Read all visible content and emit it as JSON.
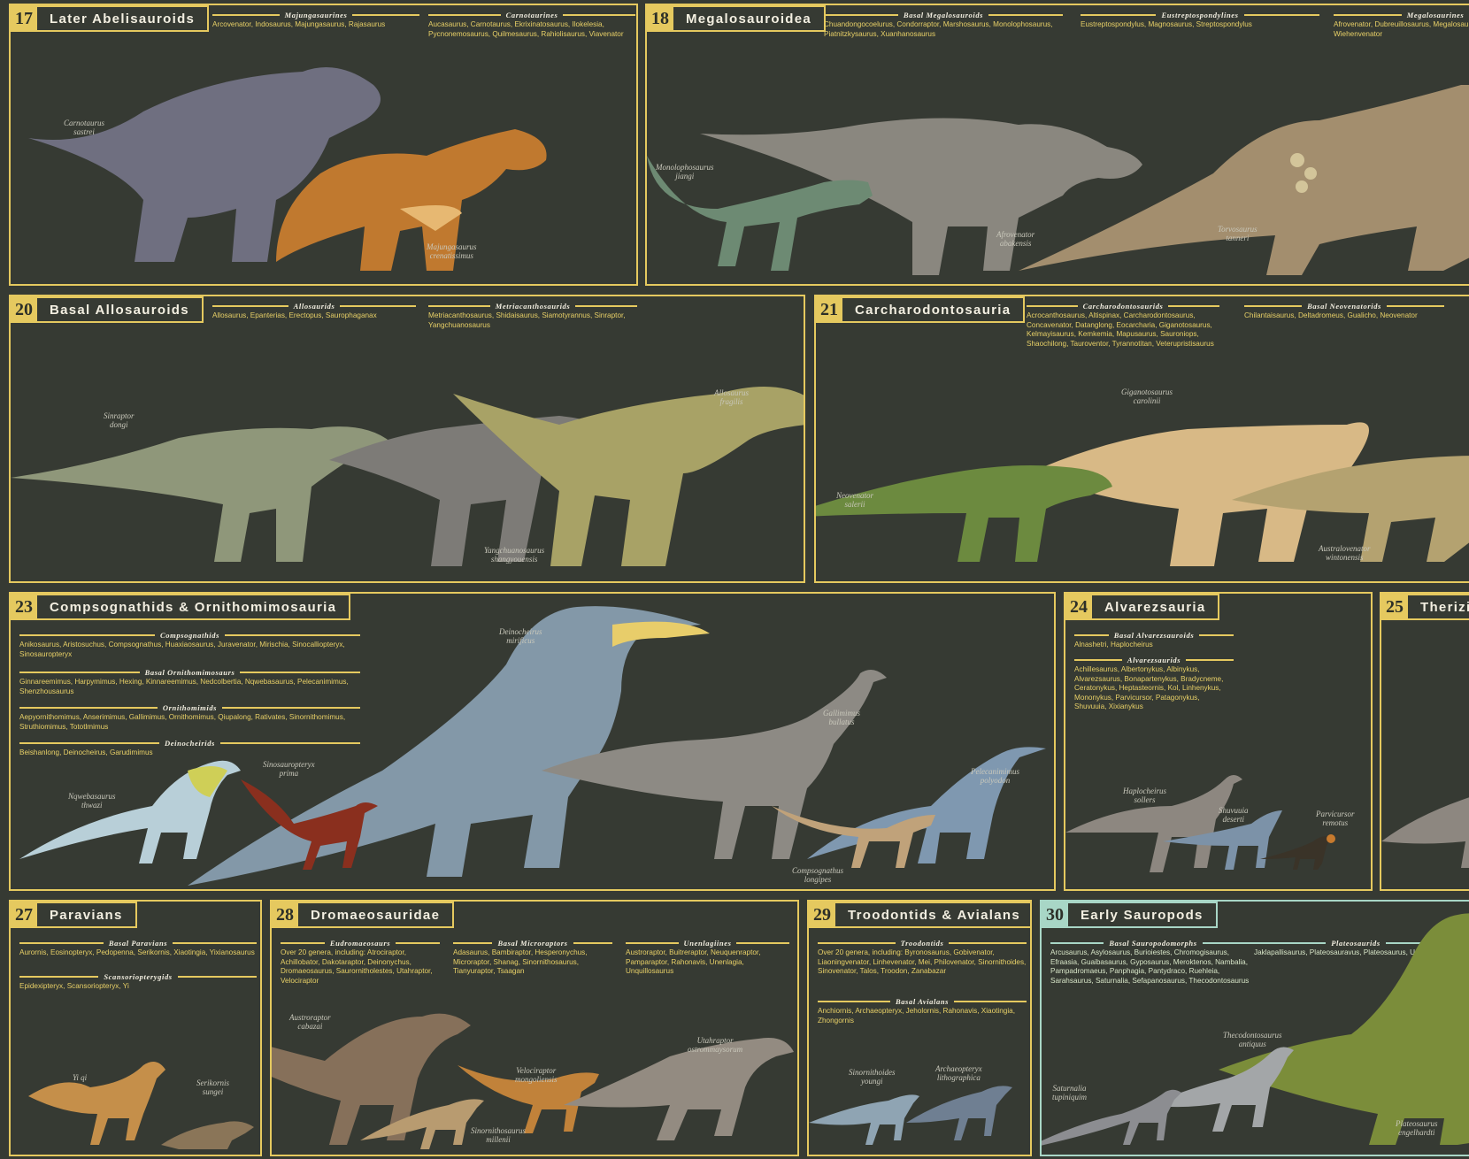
{
  "colors": {
    "background": "#363a33",
    "accent": "#e5c95f",
    "accent_mint": "#a8d6c6",
    "title_text": "#f3efe1",
    "genus_text": "#e8d067",
    "caption_text": "#c9c8bb"
  },
  "panels": [
    {
      "id": "p17",
      "num": "17",
      "title": "Later Abelisauroids",
      "groups": [
        {
          "title": "Majungasaurines",
          "text": "Arcovenator, Indosaurus, Majungasaurus, Rajasaurus"
        },
        {
          "title": "Carnotaurines",
          "text": "Aucasaurus, Carnotaurus, Ekrixinatosaurus, Ilokelesia, Pycnonemosaurus, Quilmesaurus, Rahiolisaurus, Viavenator"
        }
      ],
      "captions": [
        {
          "l1": "Carnotaurus",
          "l2": "sastrei"
        },
        {
          "l1": "Majungasaurus",
          "l2": "crenatissimus"
        }
      ]
    },
    {
      "id": "p18",
      "num": "18",
      "title": "Megalosauroidea",
      "groups": [
        {
          "title": "Basal Megalosauroids",
          "text": "Chuandongocoelurus, Condorraptor, Marshosaurus, Monolophosaurus, Piatnitzkysaurus, Xuanhanosaurus"
        },
        {
          "title": "Eustreptospondylines",
          "text": "Eustreptospondylus, Magnosaurus, Streptospondylus"
        },
        {
          "title": "Megalosaurines",
          "text": "Afrovenator, Dubreuillosaurus, Megalosaurus, Torvosaurus, Wiehenvenator"
        }
      ],
      "captions": [
        {
          "l1": "Monolophosaurus",
          "l2": "jiangi"
        },
        {
          "l1": "Afrovenator",
          "l2": "abakensis"
        },
        {
          "l1": "Torvosaurus",
          "l2": "tanneri"
        }
      ]
    },
    {
      "id": "p20",
      "num": "20",
      "title": "Basal Allosauroids",
      "groups": [
        {
          "title": "Allosaurids",
          "text": "Allosaurus, Epanterias, Erectopus, Saurophaganax"
        },
        {
          "title": "Metriacanthosaurids",
          "text": "Metriacanthosaurus, Shidaisaurus, Siamotyrannus, Sinraptor, Yangchuanosaurus"
        }
      ],
      "captions": [
        {
          "l1": "Sinraptor",
          "l2": "dongi"
        },
        {
          "l1": "Allosaurus",
          "l2": "fragilis"
        },
        {
          "l1": "Yangchuanosaurus",
          "l2": "shangyouensis"
        }
      ]
    },
    {
      "id": "p21",
      "num": "21",
      "title": "Carcharodontosauria",
      "groups": [
        {
          "title": "Carcharodontosaurids",
          "text": "Acrocanthosaurus, Altispinax, Carcharodontosaurus, Concavenator, Datanglong, Eocarcharia, Giganotosaurus, Kelmayisaurus, Kemkemia, Mapusaurus, Sauroniops, Shaochilong, Tauroventor, Tyrannotitan, Veterupristisaurus"
        },
        {
          "title": "Basal Neovenatorids",
          "text": "Chilantaisaurus, Deltadromeus, Gualicho, Neovenator"
        }
      ],
      "captions": [
        {
          "l1": "Giganotosaurus",
          "l2": "carolinii"
        },
        {
          "l1": "Neovenator",
          "l2": "salerii"
        },
        {
          "l1": "Australovenator",
          "l2": "wintonensis"
        }
      ]
    },
    {
      "id": "p23",
      "num": "23",
      "title": "Compsognathids & Ornithomimosauria",
      "groups": [
        {
          "title": "Compsognathids",
          "text": "Anikosaurus, Aristosuchus, Compsognathus, Huaxiaosaurus, Juravenator, Mirischia, Sinocalliopteryx, Sinosauropteryx"
        },
        {
          "title": "Basal Ornithomimosaurs",
          "text": "Ginnareemimus, Harpymimus, Hexing, Kinnareemimus, Nedcolbertia, Nqwebasaurus, Pelecanimimus, Shenzhousaurus"
        },
        {
          "title": "Ornithomimids",
          "text": "Aepyornithomimus, Anserimimus, Gallimimus, Ornithomimus, Qiupalong, Rativates, Sinornithomimus, Struthiomimus, Tototlmimus"
        },
        {
          "title": "Deinocheirids",
          "text": "Beishanlong, Deinocheirus, Garudimimus"
        }
      ],
      "captions": [
        {
          "l1": "Deinocheirus",
          "l2": "mirificus"
        },
        {
          "l1": "Gallimimus",
          "l2": "bullatus"
        },
        {
          "l1": "Sinosauropteryx",
          "l2": "prima"
        },
        {
          "l1": "Nqwebasaurus",
          "l2": "thwazi"
        },
        {
          "l1": "Pelecanimimus",
          "l2": "polyodon"
        },
        {
          "l1": "Compsognathus",
          "l2": "longipes"
        }
      ]
    },
    {
      "id": "p24",
      "num": "24",
      "title": "Alvarezsauria",
      "groups": [
        {
          "title": "Basal Alvarezsauroids",
          "text": "Alnashetri, Haplocheirus"
        },
        {
          "title": "Alvarezsaurids",
          "text": "Achillesaurus, Albertonykus, Albinykus, Alvarezsaurus, Bonapartenykus, Bradycneme, Ceratonykus, Heptasteornis, Kol, Linhenykus, Mononykus, Parvicursor, Patagonykus, Shuvuuia, Xixianykus"
        }
      ],
      "captions": [
        {
          "l1": "Haplocheirus",
          "l2": "sollers"
        },
        {
          "l1": "Shuvuuia",
          "l2": "deserti"
        },
        {
          "l1": "Parvicursor",
          "l2": "remotus"
        }
      ]
    },
    {
      "id": "p25",
      "num": "25",
      "title": "Therizinosauria",
      "groups": [],
      "captions": []
    },
    {
      "id": "p27",
      "num": "27",
      "title": "Paravians",
      "groups": [
        {
          "title": "Basal Paravians",
          "text": "Aurornis, Eosinopteryx, Pedopenna, Serikornis, Xiaotingia, Yixianosaurus"
        },
        {
          "title": "Scansoriopterygids",
          "text": "Epidexipteryx, Scansoriopteryx, Yi"
        }
      ],
      "captions": [
        {
          "l1": "Yi qi",
          "l2": ""
        },
        {
          "l1": "Serikornis",
          "l2": "sungei"
        }
      ]
    },
    {
      "id": "p28",
      "num": "28",
      "title": "Dromaeosauridae",
      "groups": [
        {
          "title": "Eudromaeosaurs",
          "text": "Over 20 genera, including: Atrociraptor, Achillobator, Dakotaraptor, Deinonychus, Dromaeosaurus, Saurornitholestes, Utahraptor, Velociraptor"
        },
        {
          "title": "Basal Microraptors",
          "text": "Adasaurus, Bambiraptor, Hesperonychus, Microraptor, Shanag, Sinornithosaurus, Tianyuraptor, Tsaagan"
        },
        {
          "title": "Unenlagiines",
          "text": "Austroraptor, Buitreraptor, Neuquenraptor, Pamparaptor, Rahonavis, Unenlagia, Unquillosaurus"
        }
      ],
      "captions": [
        {
          "l1": "Austroraptor",
          "l2": "cabazai"
        },
        {
          "l1": "Velociraptor",
          "l2": "mongoliensis"
        },
        {
          "l1": "Utahraptor",
          "l2": "ostrommaysorum"
        },
        {
          "l1": "Sinornithosaurus",
          "l2": "millenii"
        }
      ]
    },
    {
      "id": "p29",
      "num": "29",
      "title": "Troodontids & Avialans",
      "groups": [
        {
          "title": "Troodontids",
          "text": "Over 20 genera, including: Byronosaurus, Gobivenator, Liaoningvenator, Linhevenator, Mei, Philovenator, Sinornithoides, Sinovenator, Talos, Troodon, Zanabazar"
        },
        {
          "title": "Basal Avialans",
          "text": "Anchiornis, Archaeopteryx, Jeholornis, Rahonavis, Xiaotingia, Zhongornis"
        }
      ],
      "captions": [
        {
          "l1": "Sinornithoides",
          "l2": "youngi"
        },
        {
          "l1": "Archaeopteryx",
          "l2": "lithographica"
        }
      ]
    },
    {
      "id": "p30",
      "num": "30",
      "title": "Early Sauropods",
      "groups": [
        {
          "title": "Basal Sauropodomorphs",
          "text": "Arcusaurus, Asylosaurus, Burioiestes, Chromogisaurus, Efraasia, Guaibasaurus, Gyposaurus, Meroktenos, Nambalia, Pampadromaeus, Panphagia, Pantydraco, Ruehleia, Sarahsaurus, Saturnalia, Sefapanosaurus, Thecodontosaurus"
        },
        {
          "title": "Plateosaurids",
          "text": "Jaklapallisaurus, Plateosauravus, Plateosaurus, Unaysaurus"
        }
      ],
      "captions": [
        {
          "l1": "Thecodontosaurus",
          "l2": "antiquus"
        },
        {
          "l1": "Saturnalia",
          "l2": "tupiniquim"
        },
        {
          "l1": "Plateosaurus",
          "l2": "engelhardti"
        }
      ]
    }
  ]
}
